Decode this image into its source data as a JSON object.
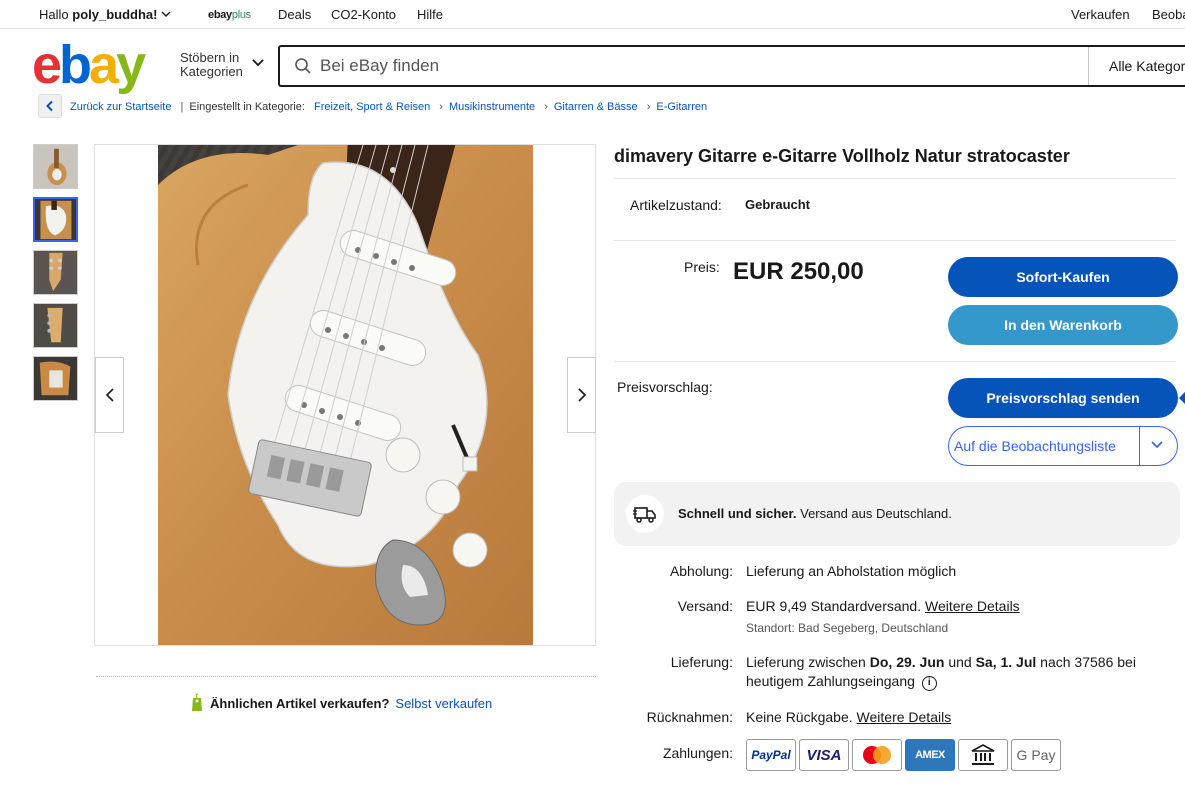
{
  "topbar": {
    "greeting_prefix": "Hallo",
    "username": "poly_buddha!",
    "ebayplus_a": "ebay",
    "ebayplus_b": "plus",
    "deals": "Deals",
    "co2": "CO2-Konto",
    "help": "Hilfe",
    "sell": "Verkaufen",
    "watch": "Beobac"
  },
  "header": {
    "logo": [
      "e",
      "b",
      "a",
      "y"
    ],
    "shop_by_category_1": "Stöbern in",
    "shop_by_category_2": "Kategorien",
    "search_placeholder": "Bei eBay finden",
    "category_select": "Alle Kategorien"
  },
  "breadcrumb": {
    "back": "Zurück zur Startseite",
    "listed_in": "Eingestellt in Kategorie:",
    "items": [
      "Freizeit, Sport & Reisen",
      "Musikinstrumente",
      "Gitarren & Bässe",
      "E-Gitarren"
    ]
  },
  "listing": {
    "title": "dimavery Gitarre e-Gitarre Vollholz Natur stratocaster",
    "condition_label": "Artikelzustand:",
    "condition_value": "Gebraucht",
    "price_label": "Preis:",
    "price_value": "EUR 250,00",
    "buy_now": "Sofort-Kaufen",
    "add_to_cart": "In den Warenkorb",
    "offer_label": "Preisvorschlag:",
    "send_offer": "Preisvorschlag senden",
    "add_to_watchlist": "Auf die Beobachtungsliste"
  },
  "shipping_box": {
    "bold": "Schnell und sicher.",
    "text": "Versand aus Deutschland."
  },
  "details": {
    "pickup_label": "Abholung:",
    "pickup_value": "Lieferung an Abholstation möglich",
    "shipping_label": "Versand:",
    "shipping_price": "EUR 9,49",
    "shipping_type": "Standardversand.",
    "shipping_more": "Weitere Details",
    "location": "Standort: Bad Segeberg, Deutschland",
    "delivery_label": "Lieferung:",
    "delivery_1": "Lieferung zwischen",
    "delivery_date1": "Do, 29. Jun",
    "delivery_und": "und",
    "delivery_date2": "Sa, 1. Jul",
    "delivery_2": "nach 37586 bei",
    "delivery_3": "heutigem Zahlungseingang",
    "returns_label": "Rücknahmen:",
    "returns_value": "Keine Rückgabe.",
    "returns_more": "Weitere Details",
    "payments_label": "Zahlungen:",
    "payments": [
      "PayPal",
      "VISA",
      "Mastercard",
      "AMEX",
      "Bank",
      "G Pay"
    ]
  },
  "sell_similar": {
    "question": "Ähnlichen Artikel verkaufen?",
    "link": "Selbst verkaufen"
  },
  "colors": {
    "primary_blue": "#0654ba",
    "light_blue": "#3498ca",
    "link_blue": "#3665f3"
  }
}
